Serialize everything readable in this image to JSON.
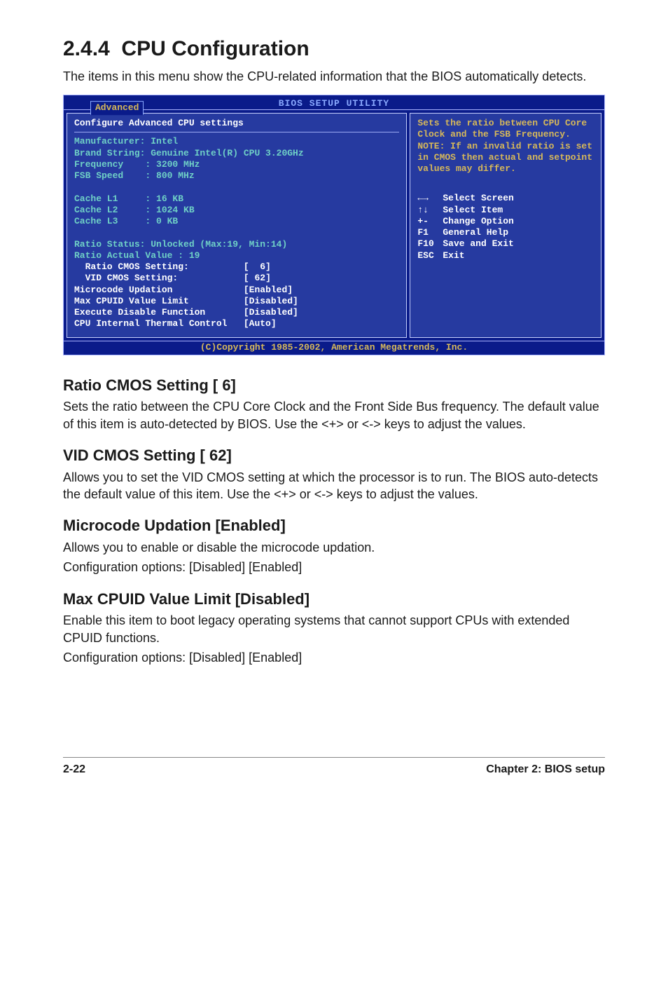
{
  "section": {
    "number": "2.4.4",
    "title": "CPU Configuration",
    "intro": "The items in this menu show the CPU-related information that the BIOS automatically detects."
  },
  "bios": {
    "header_title": "BIOS SETUP UTILITY",
    "tab": "Advanced",
    "left_title": "Configure Advanced CPU settings",
    "info": {
      "manufacturer": "Manufacturer: Intel",
      "brand": "Brand String: Genuine Intel(R) CPU 3.20GHz",
      "frequency": "Frequency    : 3200 MHz",
      "fsb": "FSB Speed    : 800 MHz",
      "l1": "Cache L1     : 16 KB",
      "l2": "Cache L2     : 1024 KB",
      "l3": "Cache L3     : 0 KB",
      "ratio_status": "Ratio Status: Unlocked (Max:19, Min:14)",
      "ratio_actual": "Ratio Actual Value : 19"
    },
    "settings": {
      "ratio_cmos_label": "  Ratio CMOS Setting:",
      "ratio_cmos_value": "[  6]",
      "vid_cmos_label": "  VID CMOS Setting:",
      "vid_cmos_value": "[ 62]",
      "microcode_label": "Microcode Updation",
      "microcode_value": "[Enabled]",
      "maxcpuid_label": "Max CPUID Value Limit",
      "maxcpuid_value": "[Disabled]",
      "exec_disable_label": "Execute Disable Function",
      "exec_disable_value": "[Disabled]",
      "thermal_label": "CPU Internal Thermal Control",
      "thermal_value": "[Auto]"
    },
    "right_help": "Sets the ratio between CPU Core Clock and the FSB Frequency.\nNOTE: If an invalid ratio is set in CMOS then actual and setpoint values may differ.",
    "keys": [
      {
        "key": "←→",
        "label": "Select Screen"
      },
      {
        "key": "↑↓",
        "label": "Select Item"
      },
      {
        "key": "+-",
        "label": "Change Option"
      },
      {
        "key": "F1",
        "label": "General Help"
      },
      {
        "key": "F10",
        "label": "Save and Exit"
      },
      {
        "key": "ESC",
        "label": "Exit"
      }
    ],
    "footer": "(C)Copyright 1985-2002, American Megatrends, Inc."
  },
  "subsections": {
    "ratio": {
      "title": "Ratio CMOS Setting [ 6]",
      "body": "Sets the ratio between the CPU Core Clock and the Front Side Bus frequency. The default value of this item is auto-detected by BIOS. Use the <+> or <-> keys to adjust the values."
    },
    "vid": {
      "title": "VID CMOS Setting [ 62]",
      "body": "Allows you to set the VID CMOS setting at which the processor is to run. The BIOS auto-detects the default value of this item. Use the <+> or  <-> keys to adjust the values."
    },
    "microcode": {
      "title": "Microcode Updation [Enabled]",
      "body1": "Allows you to enable or disable the microcode updation.",
      "body2": "Configuration options: [Disabled] [Enabled]"
    },
    "maxcpuid": {
      "title": "Max CPUID Value Limit [Disabled]",
      "body1": "Enable this item to boot legacy operating systems that cannot support CPUs with extended CPUID functions.",
      "body2": "Configuration options: [Disabled] [Enabled]"
    }
  },
  "footer": {
    "left": "2-22",
    "right": "Chapter 2: BIOS setup"
  }
}
